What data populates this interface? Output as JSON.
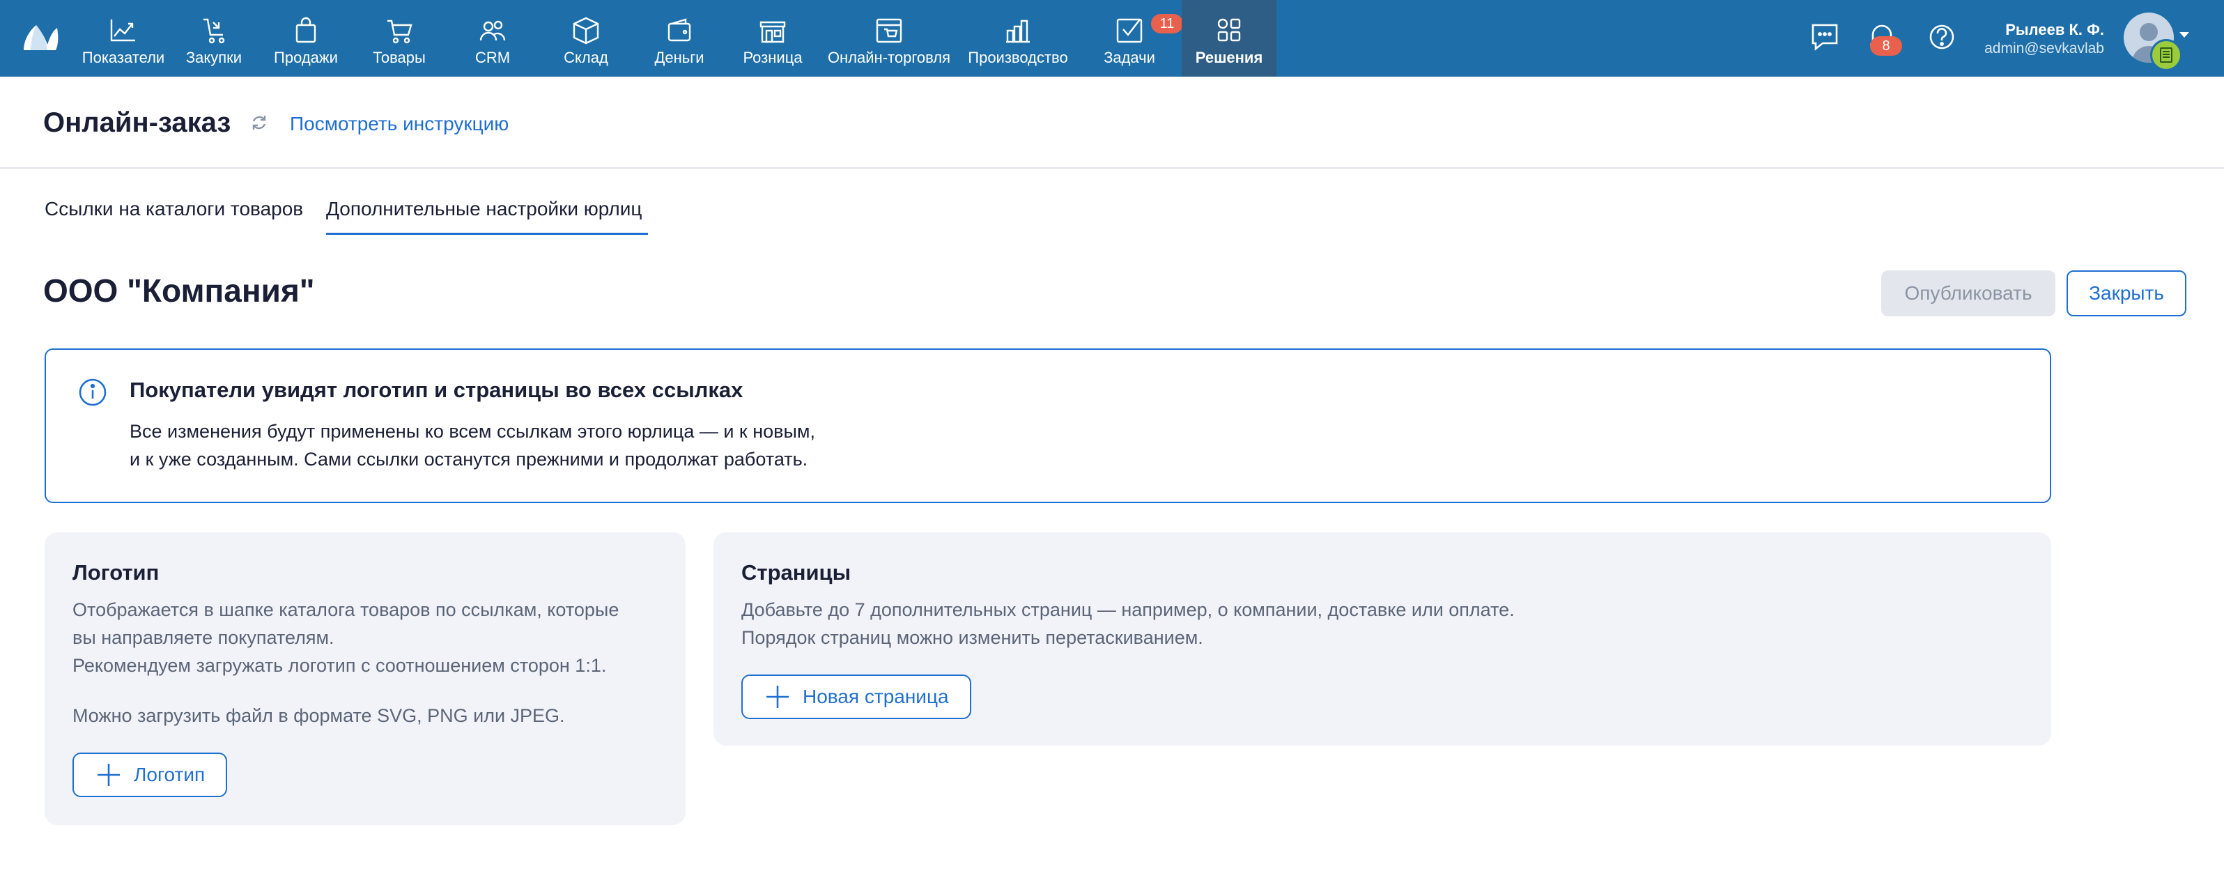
{
  "nav": {
    "items": [
      {
        "label": "Показатели",
        "icon": "chart-line-icon"
      },
      {
        "label": "Закупки",
        "icon": "purchase-icon"
      },
      {
        "label": "Продажи",
        "icon": "shopping-bag-icon"
      },
      {
        "label": "Товары",
        "icon": "cart-icon"
      },
      {
        "label": "CRM",
        "icon": "people-icon"
      },
      {
        "label": "Склад",
        "icon": "box-icon"
      },
      {
        "label": "Деньги",
        "icon": "wallet-icon"
      },
      {
        "label": "Розница",
        "icon": "store-icon"
      },
      {
        "label": "Онлайн-торговля",
        "icon": "online-store-icon"
      },
      {
        "label": "Производство",
        "icon": "factory-icon"
      },
      {
        "label": "Задачи",
        "icon": "tasks-icon",
        "badge": "11"
      },
      {
        "label": "Решения",
        "icon": "apps-icon",
        "active": true
      }
    ]
  },
  "header_tools": {
    "notifications_badge": "8",
    "icons": [
      "chat-icon",
      "bell-icon",
      "help-icon"
    ]
  },
  "user": {
    "name": "Рылеев К. Ф.",
    "email": "admin@sevkavlab"
  },
  "page": {
    "title": "Онлайн-заказ",
    "instruction_link": "Посмотреть инструкцию"
  },
  "tabs": [
    {
      "label": "Ссылки на каталоги товаров",
      "active": false
    },
    {
      "label": "Дополнительные настройки юрлиц",
      "active": true
    }
  ],
  "company": {
    "name": "ООО \"Компания\"",
    "publish_label": "Опубликовать",
    "close_label": "Закрыть"
  },
  "info": {
    "title": "Покупатели увидят логотип и страницы во всех ссылках",
    "line1": "Все изменения будут применены ко всем ссылкам этого юрлица — и к новым,",
    "line2": "и к уже созданным. Сами ссылки останутся прежними и продолжат работать."
  },
  "logo_card": {
    "title": "Логотип",
    "line1": "Отображается в шапке каталога товаров по ссылкам, которые",
    "line2": "вы направляете покупателям.",
    "line3": "Рекомендуем загружать логотип с соотношением сторон 1:1.",
    "line4": "Можно загрузить файл в формате SVG, PNG или JPEG.",
    "button": "Логотип"
  },
  "pages_card": {
    "title": "Страницы",
    "line1": "Добавьте до 7 дополнительных страниц — например, о компании, доставке или оплате.",
    "line2": "Порядок страниц можно изменить перетаскиванием.",
    "button": "Новая страница"
  },
  "colors": {
    "topbar": "#1e6fa9",
    "active_nav": "#2e5e85",
    "accent": "#1f6fd1",
    "badge": "#e9614c",
    "card_bg": "#f1f3f8"
  }
}
